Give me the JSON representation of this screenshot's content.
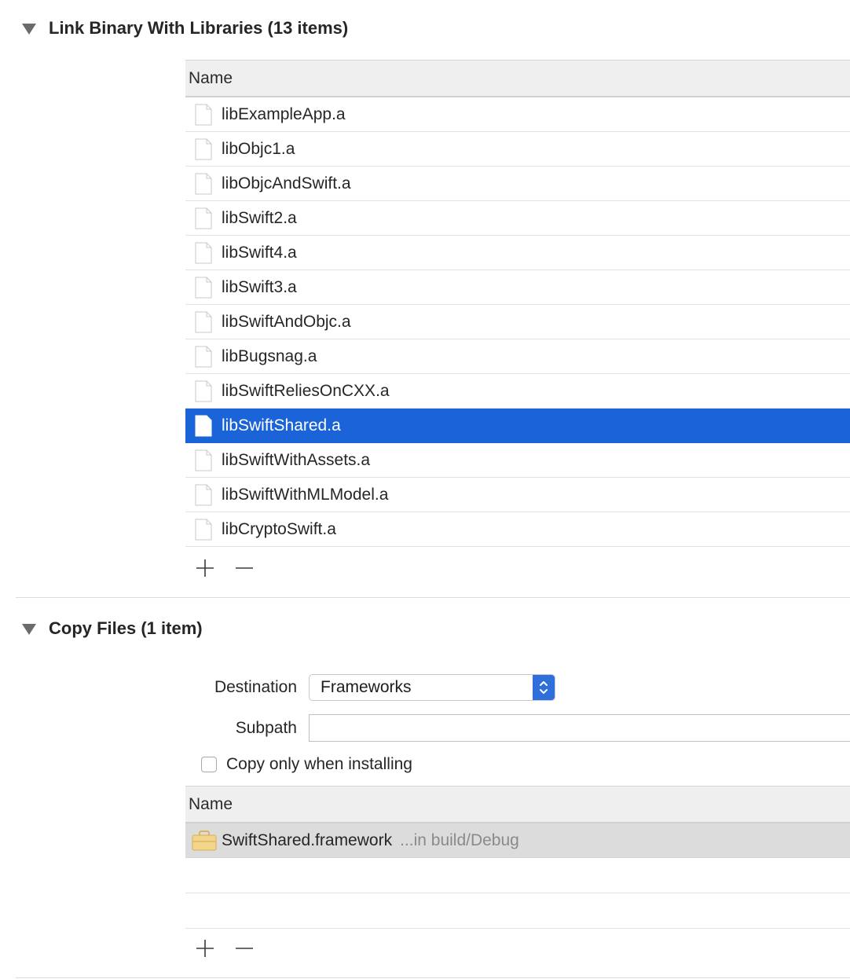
{
  "link_section": {
    "title": "Link Binary With Libraries (13 items)",
    "column_header": "Name",
    "rows": [
      {
        "label": "libExampleApp.a",
        "selected": false
      },
      {
        "label": "libObjc1.a",
        "selected": false
      },
      {
        "label": "libObjcAndSwift.a",
        "selected": false
      },
      {
        "label": "libSwift2.a",
        "selected": false
      },
      {
        "label": "libSwift4.a",
        "selected": false
      },
      {
        "label": "libSwift3.a",
        "selected": false
      },
      {
        "label": "libSwiftAndObjc.a",
        "selected": false
      },
      {
        "label": "libBugsnag.a",
        "selected": false
      },
      {
        "label": "libSwiftReliesOnCXX.a",
        "selected": false
      },
      {
        "label": "libSwiftShared.a",
        "selected": true
      },
      {
        "label": "libSwiftWithAssets.a",
        "selected": false
      },
      {
        "label": "libSwiftWithMLModel.a",
        "selected": false
      },
      {
        "label": "libCryptoSwift.a",
        "selected": false
      }
    ],
    "add_label": "+",
    "remove_label": "−"
  },
  "copy_section": {
    "title": "Copy Files (1 item)",
    "destination_label": "Destination",
    "destination_value": "Frameworks",
    "subpath_label": "Subpath",
    "subpath_value": "",
    "checkbox_label": "Copy only when installing",
    "checkbox_checked": false,
    "column_header": "Name",
    "rows": [
      {
        "label": "SwiftShared.framework",
        "sublabel": "...in build/Debug",
        "icon": "framework-icon"
      }
    ],
    "add_label": "+",
    "remove_label": "−"
  },
  "colors": {
    "selection": "#1b63d8",
    "stepper": "#2f6fdc"
  }
}
